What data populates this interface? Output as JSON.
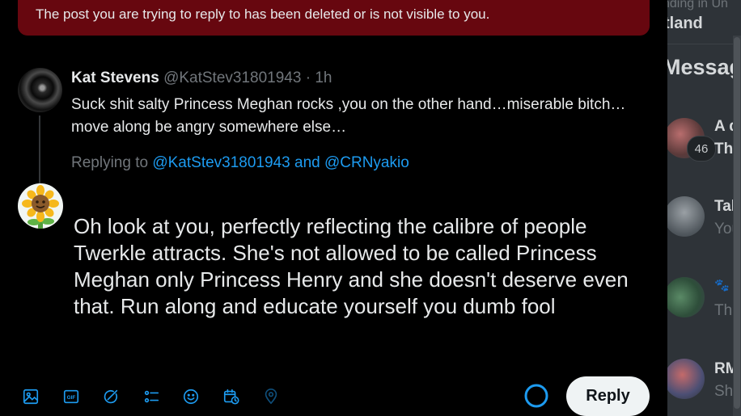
{
  "notice": {
    "text": "The post you are trying to reply to has been deleted or is not visible to you."
  },
  "parent_post": {
    "name": "Kat Stevens",
    "handle": "@KatStev31801943",
    "separator": "·",
    "time": "1h",
    "text": "Suck shit salty Princess Meghan rocks ,you on the other hand…miserable bitch… move along be angry somewhere else…",
    "replying_prefix": "Replying to",
    "replying_user1": "@KatStev31801943",
    "replying_and": "and",
    "replying_user2": "@CRNyakio"
  },
  "compose": {
    "text": "Oh look at you, perfectly reflecting the calibre of people Twerkle attracts. She's not allowed to be called Princess Meghan only Princess Henry and she doesn't deserve even that. Run along and educate yourself you dumb fool"
  },
  "toolbar": {
    "icons": [
      "media-icon",
      "gif-icon",
      "grok-icon",
      "poll-icon",
      "emoji-icon",
      "schedule-icon",
      "location-icon"
    ],
    "reply_label": "Reply",
    "accent": "#1d9bf0"
  },
  "background": {
    "trend_sub": "nding in Un",
    "trend_title": "tland",
    "messages_title": "Messag",
    "badge": "46",
    "conversations": [
      {
        "name": "A d",
        "preview": "The"
      },
      {
        "name": "Tak",
        "preview": "You"
      },
      {
        "name": "🐾 🐾",
        "preview": "Tha"
      },
      {
        "name": "RM",
        "preview": "Sha"
      }
    ]
  },
  "colors": {
    "notice_bg": "#67070f",
    "link": "#1d9bf0",
    "muted": "#71767b",
    "reply_button_bg": "#eff3f4"
  }
}
